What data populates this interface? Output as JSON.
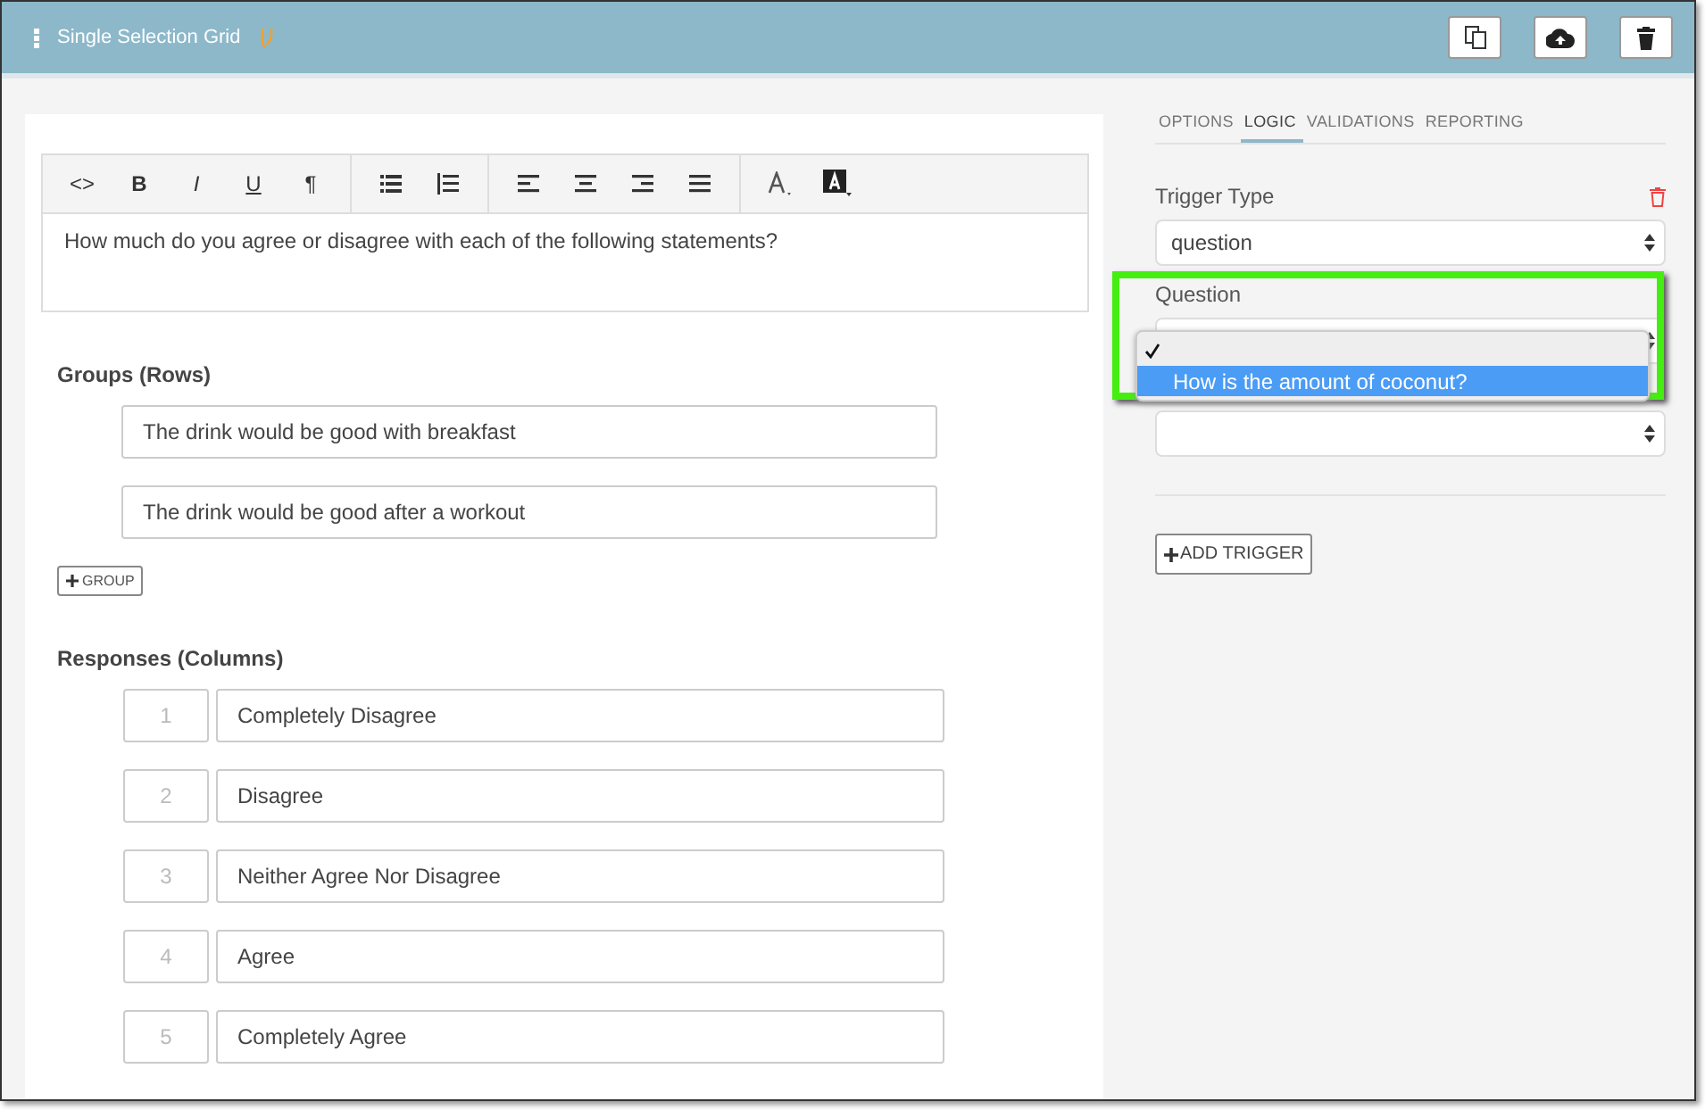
{
  "header": {
    "title": "Single Selection Grid"
  },
  "editor": {
    "toolbar": [
      [
        {
          "kind": "code",
          "label": "<>"
        },
        {
          "kind": "bold",
          "label": "B"
        },
        {
          "kind": "italic",
          "label": "I"
        },
        {
          "kind": "underline",
          "label": "U"
        },
        {
          "kind": "paragraph",
          "label": "¶"
        }
      ],
      [
        {
          "kind": "bullets"
        },
        {
          "kind": "numbers"
        }
      ],
      [
        {
          "kind": "align-left"
        },
        {
          "kind": "align-center"
        },
        {
          "kind": "align-right"
        },
        {
          "kind": "justify"
        }
      ],
      [
        {
          "kind": "font-color"
        },
        {
          "kind": "highlight"
        }
      ]
    ],
    "text": "How much do you agree or disagree with each of the following statements?"
  },
  "groups": {
    "heading": "Groups (Rows)",
    "rows": [
      "The drink would be good with breakfast",
      "The drink would be good after a workout"
    ],
    "add_button": "GROUP"
  },
  "responses": {
    "heading": "Responses (Columns)",
    "rows": [
      {
        "value": "1",
        "label": "Completely Disagree"
      },
      {
        "value": "2",
        "label": "Disagree"
      },
      {
        "value": "3",
        "label": "Neither Agree Nor Disagree"
      },
      {
        "value": "4",
        "label": "Agree"
      },
      {
        "value": "5",
        "label": "Completely Agree"
      }
    ]
  },
  "tabs": [
    {
      "label": "OPTIONS",
      "selected": false
    },
    {
      "label": "LOGIC",
      "selected": true
    },
    {
      "label": "VALIDATIONS",
      "selected": false
    },
    {
      "label": "REPORTING",
      "selected": false
    }
  ],
  "logic": {
    "trigger_type_label": "Trigger Type",
    "trigger_type": "question",
    "question_label": "Question",
    "dropdown": [
      {
        "selected": true,
        "highlighted": false
      },
      {
        "label": "How is the amount of coconut?",
        "selected": false,
        "highlighted": true
      }
    ],
    "add_trigger": "ADD TRIGGER"
  }
}
